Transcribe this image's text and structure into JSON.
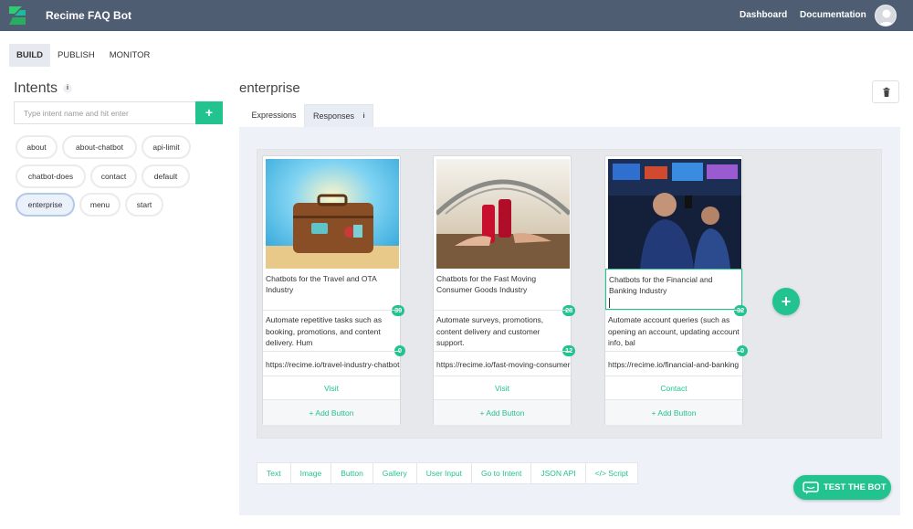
{
  "header": {
    "app_title": "Recime FAQ Bot",
    "nav": [
      "Dashboard",
      "Documentation"
    ],
    "logo_icon": "recime-logo-icon",
    "avatar_icon": "user-avatar-icon"
  },
  "main_tabs": [
    "BUILD",
    "PUBLISH",
    "MONITOR"
  ],
  "active_main_tab": "BUILD",
  "intents": {
    "title": "Intents",
    "info_glyph": "i",
    "input_placeholder": "Type intent name and hit enter",
    "add_label": "+",
    "items": [
      "about",
      "about-chatbot",
      "api-limit",
      "chatbot-does",
      "contact",
      "default",
      "enterprise",
      "menu",
      "start"
    ],
    "active": "enterprise"
  },
  "content": {
    "title": "enterprise",
    "tabs": [
      "Expressions",
      "Responses"
    ],
    "active_tab": "Responses",
    "info_glyph": "i",
    "trash_icon": "trash-icon"
  },
  "cards": [
    {
      "image": "suitcase-beach-photo",
      "title": "Chatbots for the Travel and OTA Industry",
      "title_badge": "39",
      "description": "Automate repetitive tasks such as booking, promotions, and content delivery. Hum",
      "desc_badge": "0",
      "url": "https://recime.io/travel-industry-chatbots",
      "button": "Visit",
      "add_button": "Add Button"
    },
    {
      "image": "coca-cola-bridge-photo",
      "title": "Chatbots for the Fast Moving Consumer Goods Industry",
      "title_badge": "28",
      "description": "Automate surveys, promotions, content delivery and customer support.",
      "desc_badge": "12",
      "url": "https://recime.io/fast-moving-consumer-goods",
      "button": "Visit",
      "add_button": "Add Button"
    },
    {
      "image": "stock-exchange-trader-photo",
      "title": "Chatbots for the Financial and Banking Industry",
      "title_badge": "32",
      "description": "Automate account queries (such as opening an account, updating account info, bal",
      "desc_badge": "0",
      "url": "https://recime.io/financial-and-banking",
      "button": "Contact",
      "add_button": "Add Button"
    }
  ],
  "add_card_label": "+",
  "toolbar": [
    "Text",
    "Image",
    "Button",
    "Gallery",
    "User Input",
    "Go to Intent",
    "JSON API",
    "</> Script"
  ],
  "test_bot_label": "TEST THE BOT",
  "colors": {
    "topbar": "#4f5d73",
    "accent": "#22c38e",
    "panel": "#eef2f8"
  }
}
